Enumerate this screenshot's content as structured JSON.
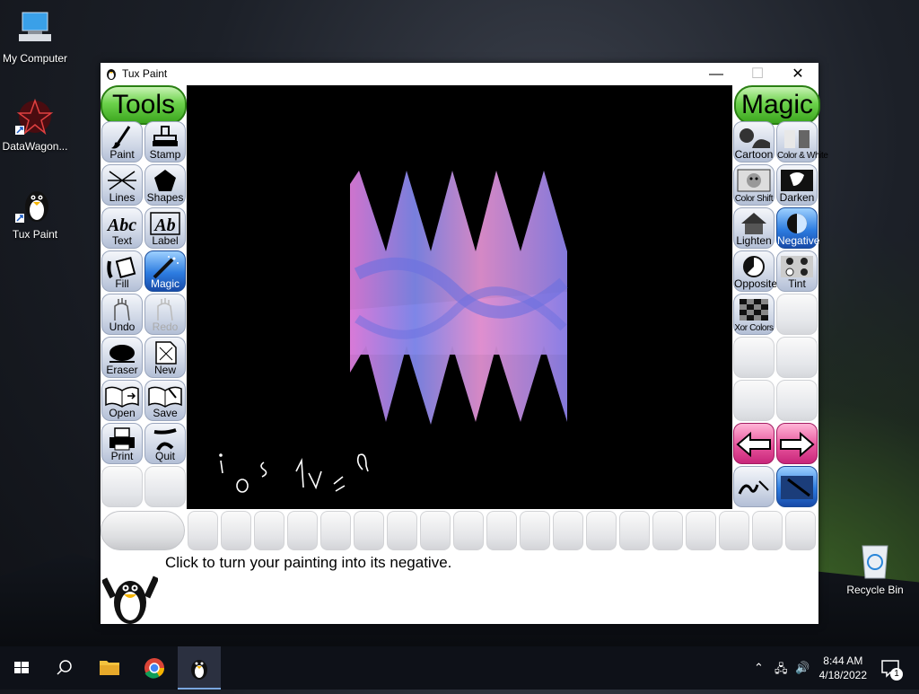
{
  "desktop": {
    "icons": [
      {
        "label": "My Computer"
      },
      {
        "label": "DataWagon..."
      },
      {
        "label": "Tux Paint"
      },
      {
        "label": "Recycle Bin"
      }
    ]
  },
  "window": {
    "title": "Tux Paint",
    "controls": {
      "minimize": "—",
      "maximize": "☐",
      "close": "✕"
    }
  },
  "tools": {
    "header": "Tools",
    "items": [
      {
        "label": "Paint"
      },
      {
        "label": "Stamp"
      },
      {
        "label": "Lines"
      },
      {
        "label": "Shapes"
      },
      {
        "label": "Text"
      },
      {
        "label": "Label"
      },
      {
        "label": "Fill"
      },
      {
        "label": "Magic",
        "active": true
      },
      {
        "label": "Undo"
      },
      {
        "label": "Redo",
        "disabled": true
      },
      {
        "label": "Eraser"
      },
      {
        "label": "New"
      },
      {
        "label": "Open"
      },
      {
        "label": "Save"
      },
      {
        "label": "Print"
      },
      {
        "label": "Quit"
      }
    ]
  },
  "magic": {
    "header": "Magic",
    "items": [
      {
        "label": "Cartoon"
      },
      {
        "label": "Color & White"
      },
      {
        "label": "Color Shift"
      },
      {
        "label": "Darken"
      },
      {
        "label": "Lighten"
      },
      {
        "label": "Negative",
        "active": true
      },
      {
        "label": "Opposite"
      },
      {
        "label": "Tint"
      },
      {
        "label": "Xor Colors"
      }
    ]
  },
  "canvas": {
    "scribble_text": "i o s  1 L z a"
  },
  "status": {
    "message": "Click to turn your painting into its negative."
  },
  "taskbar": {
    "time": "8:44 AM",
    "date": "4/18/2022",
    "notification_count": "1"
  },
  "colors": {
    "tools_header": "#5fcc3f",
    "active_button": "#2d7ce0",
    "nav_arrow": "#e8559d",
    "canvas_bg": "#000000"
  }
}
